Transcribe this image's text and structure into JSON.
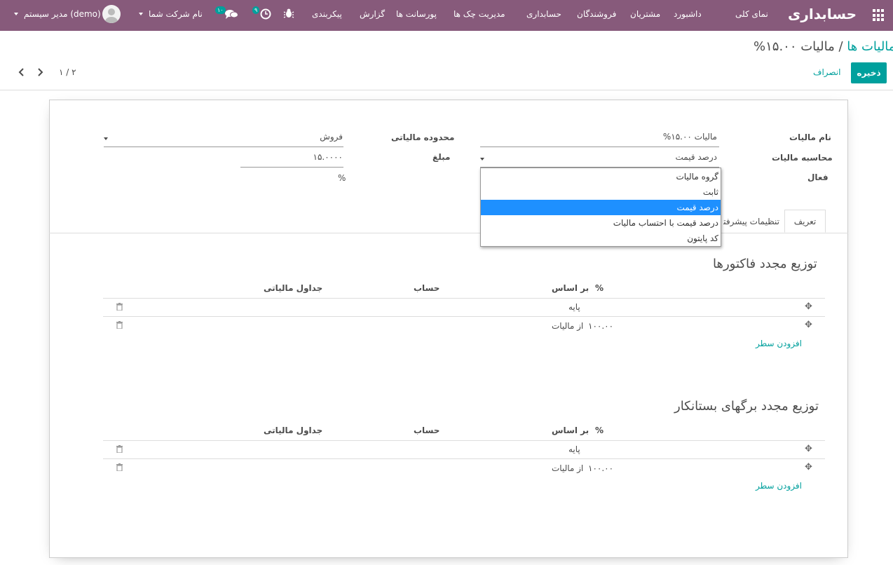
{
  "navbar": {
    "brand": "حسابداری",
    "menu": [
      "نمای کلی",
      "داشبورد",
      "مشتریان",
      "فروشندگان",
      "حسابداری",
      "مدیریت چک ها",
      "پورسانت ها",
      "گزارش",
      "پیکربندی"
    ],
    "messages_count": "۱۰",
    "activities_count": "۹",
    "company": "نام شرکت شما",
    "user": "مدیر سیستم (demo)"
  },
  "control_panel": {
    "breadcrumb_parent": "مالیات ها",
    "breadcrumb_sep": "/",
    "breadcrumb_current": "مالیات ۱۵.۰۰%",
    "save_label": "ذخیره",
    "discard_label": "انصراف",
    "pager": "۱ / ۲"
  },
  "form": {
    "tax_name_label": "نام مالیات",
    "tax_name_value": "مالیات ۱۵.۰۰%",
    "tax_computation_label": "محاسبه مالیات",
    "tax_computation_value": "درصد قیمت",
    "active_label": "فعال",
    "tax_scope_label": "محدوده مالیاتی",
    "tax_scope_value": "فروش",
    "amount_label": "مبلغ",
    "amount_value": "۱۵.۰۰۰۰",
    "amount_unit": "%"
  },
  "dropdown": {
    "options": [
      "گروه مالیات",
      "ثابت",
      "درصد قیمت",
      "درصد قیمت با احتساب مالیات",
      "کد پایتون"
    ],
    "selected_index": 2
  },
  "tabs": [
    "تعریف",
    "تنظیمات پیشرفته"
  ],
  "sections": [
    {
      "title": "توزیع مجدد فاکتورها",
      "headers": {
        "percent": "%",
        "based_on": "بر اساس",
        "account": "حساب",
        "tax_grids": "جداول مالیاتی"
      },
      "rows": [
        {
          "percent": "",
          "based_on": "پایه"
        },
        {
          "percent": "۱۰۰.۰۰",
          "based_on": "از مالیات"
        }
      ],
      "add_line": "افزودن سطر"
    },
    {
      "title": "توزیع مجدد برگهای بستانکار",
      "headers": {
        "percent": "%",
        "based_on": "بر اساس",
        "account": "حساب",
        "tax_grids": "جداول مالیاتی"
      },
      "rows": [
        {
          "percent": "",
          "based_on": "پایه"
        },
        {
          "percent": "۱۰۰.۰۰",
          "based_on": "از مالیات"
        }
      ],
      "add_line": "افزودن سطر"
    }
  ],
  "colors": {
    "navbar": "#875a7b",
    "primary": "#00a09d",
    "selected_option": "#1e90ff"
  }
}
